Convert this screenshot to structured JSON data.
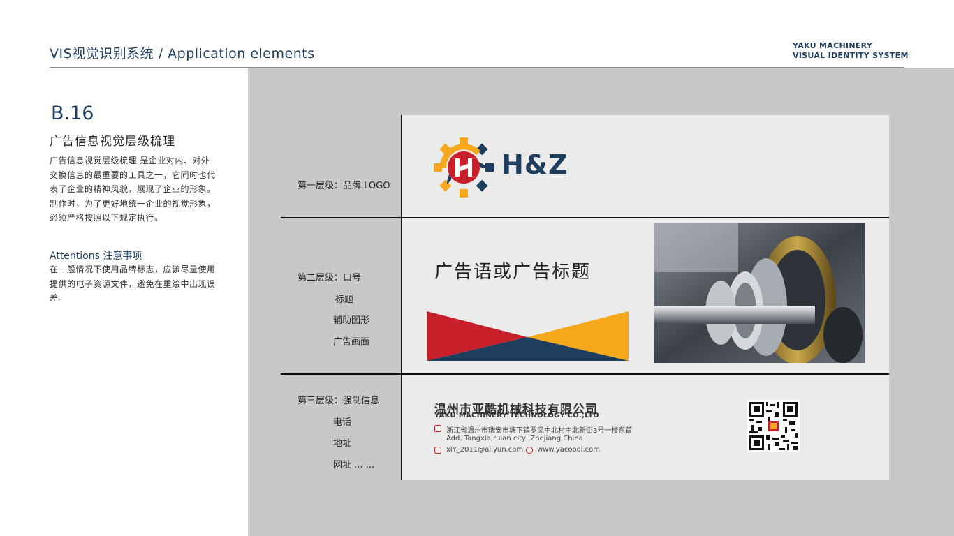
{
  "header": {
    "title": "VIS视觉识别系统 / Application elements",
    "brand_line1": "YAKU MACHINERY",
    "brand_line2": "VISUAL IDENTITY SYSTEM"
  },
  "section": {
    "code": "B.16",
    "title": "广告信息视觉层级梳理",
    "body": "广告信息视觉层级梳理 是企业对内、对外交换信息的最重要的工具之一，它同时也代表了企业的精神风貌，展现了企业的形象。制作时，为了更好地统一企业的视觉形象，必须严格按照以下规定执行。",
    "attention_title": "Attentions 注意事项",
    "attention_body": "在一般情况下使用品牌标志，应该尽量使用提供的电子资源文件，避免在重绘中出现误差。"
  },
  "levels": {
    "level1": "第一层级：品牌 LOGO",
    "level2": "第二层级：口号",
    "level2_items": [
      "标题",
      "辅助图形",
      "广告画面"
    ],
    "level3": "第三层级：强制信息",
    "level3_items": [
      "电话",
      "地址",
      "网址 ... ..."
    ]
  },
  "ad": {
    "logo_text": "H&Z",
    "slogan": "广告语或广告标题",
    "company_cn": "温州市亚酷机械科技有限公司",
    "company_en": "YAKU MACHINERY TECHNOLOGY CO.,LTD",
    "address_cn": "浙江省温州市瑞安市塘下镇罗凤中北村中北新街3号一楼东首",
    "address_en": "Add. Tangxia,ruian city ,Zhejiang,China",
    "email": "xlY_2011@aliyun.com",
    "website": "www.yacoool.com"
  },
  "colors": {
    "navy": "#1f3d5c",
    "red": "#c8202a",
    "yellow": "#f5a81c",
    "panel_gray": "#c8c8c9",
    "card_gray": "#ebebeb"
  },
  "icons": [
    "gear-logo-icon",
    "location-icon",
    "email-icon",
    "web-icon",
    "qr-code"
  ]
}
